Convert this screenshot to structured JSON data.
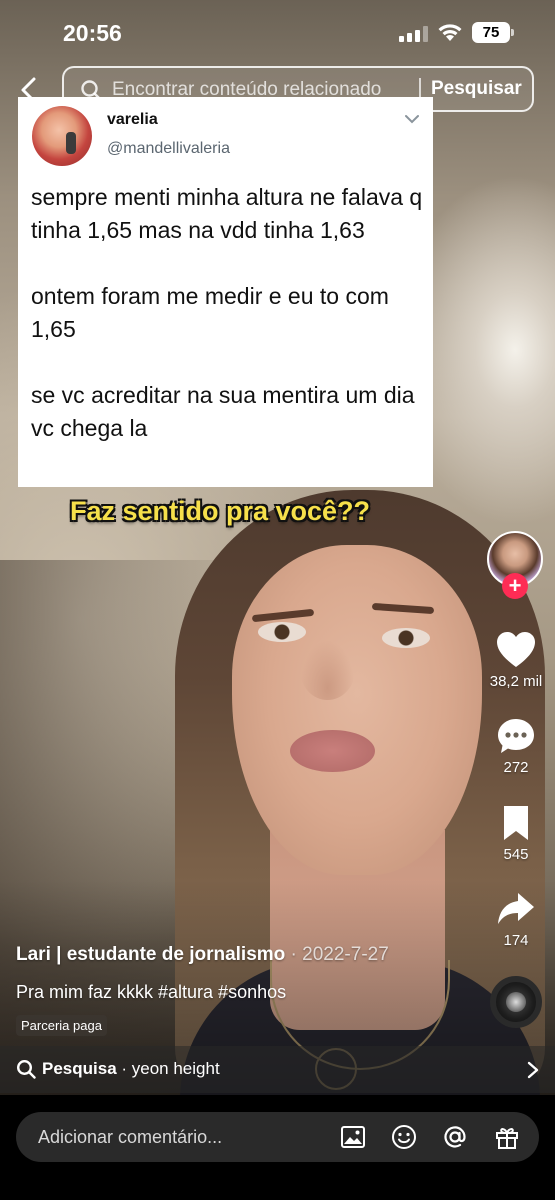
{
  "status_bar": {
    "time": "20:56",
    "battery": "75"
  },
  "search": {
    "placeholder": "Encontrar conteúdo relacionado",
    "button_label": "Pesquisar"
  },
  "tweet": {
    "display_name": "varelia",
    "handle": "@mandellivaleria",
    "text": "sempre menti minha altura ne falava q tinha 1,65 mas na vdd tinha 1,63\n\nontem foram me medir e eu to com 1,65\n\nse vc acreditar na sua mentira um dia vc chega la"
  },
  "video": {
    "overlay_caption": "Faz sentido pra você??",
    "author": "Lari | estudante de jornalismo",
    "date_separator": " · ",
    "date": "2022-7-27",
    "caption": "Pra mim faz kkkk #altura #sonhos",
    "paid_label": "Parceria paga"
  },
  "actions": {
    "likes": "38,2 mil",
    "comments": "272",
    "saves": "545",
    "shares": "174"
  },
  "related_search": {
    "label": "Pesquisa",
    "separator": " · ",
    "query": "yeon height"
  },
  "comment_bar": {
    "placeholder": "Adicionar comentário..."
  },
  "colors": {
    "follow_accent": "#fe2c55",
    "caption_yellow": "#f6e04b"
  },
  "icons": [
    "back-icon",
    "search-icon",
    "chevron-down-icon",
    "plus-icon",
    "heart-icon",
    "comment-icon",
    "bookmark-icon",
    "share-icon",
    "music-disc-icon",
    "chevron-right-icon",
    "image-icon",
    "emoji-icon",
    "mention-icon",
    "gift-icon"
  ]
}
